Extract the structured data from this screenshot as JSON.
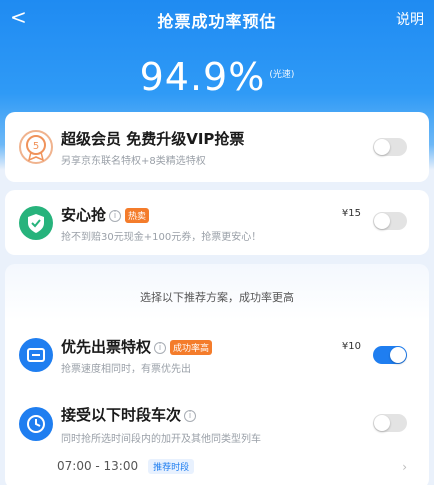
{
  "header": {
    "back_glyph": "<",
    "title": "抢票成功率预估",
    "help_label": "说明",
    "rate_value": "94.9%",
    "rate_tag": "(光速)"
  },
  "items": [
    {
      "title": "超级会员 免费升级VIP抢票",
      "subtitle": "另享京东联名特权+8类精选特权",
      "icon": "vip-medal-icon",
      "enabled": false
    },
    {
      "title": "安心抢",
      "badge": "热卖",
      "subtitle": "抢不到赔30元现金+100元券，抢票更安心！",
      "price": "¥15",
      "icon": "shield-check-icon",
      "enabled": false
    }
  ],
  "recommend": {
    "note": "选择以下推荐方案，成功率更高",
    "options": [
      {
        "title": "优先出票特权",
        "badge": "成功率高",
        "subtitle": "抢票速度相同时，有票优先出",
        "price": "¥10",
        "icon": "ticket-icon",
        "enabled": true
      },
      {
        "title": "接受以下时段车次",
        "subtitle": "同时抢所选时间段内的加开及其他同类型列车",
        "icon": "clock-icon",
        "enabled": false,
        "time_range": "07:00 - 13:00",
        "time_tag": "推荐时段"
      }
    ]
  },
  "colors": {
    "primary": "#1f7ef0",
    "header": "#2f9af6",
    "badge": "#f47c2b"
  }
}
